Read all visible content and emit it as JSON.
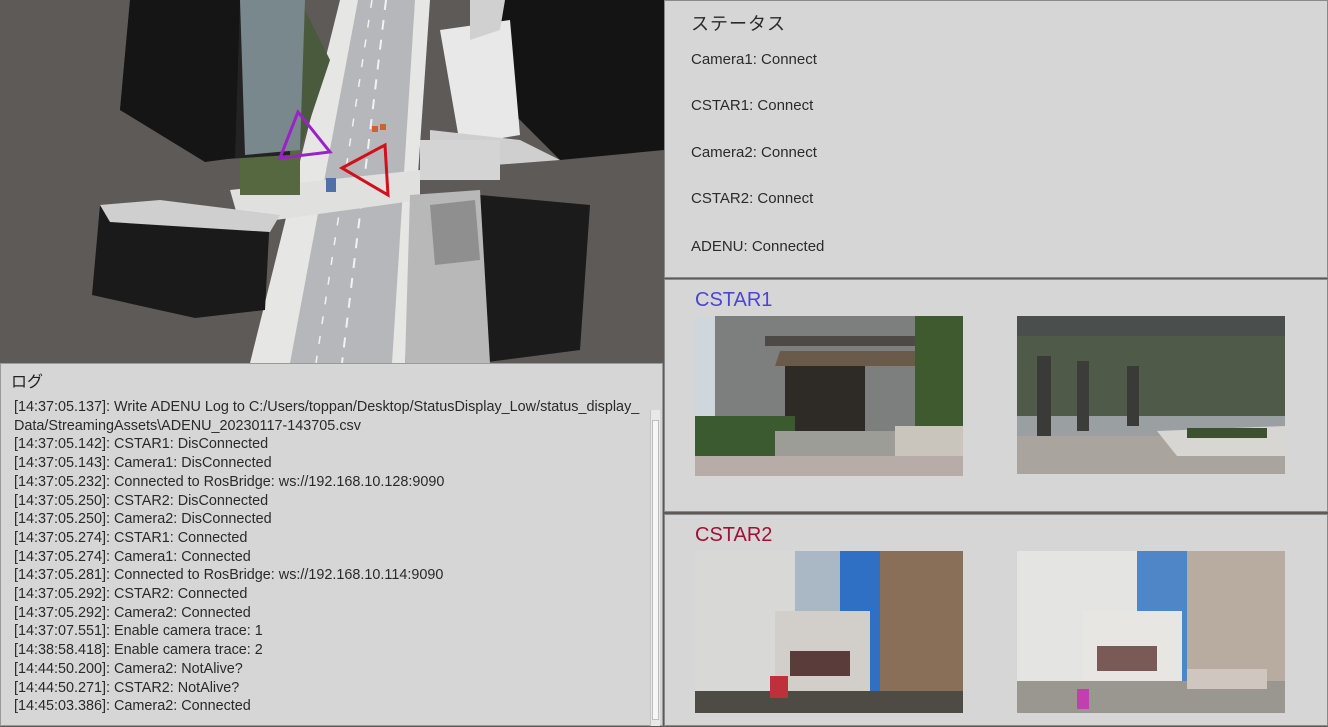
{
  "status": {
    "title": "ステータス",
    "items": [
      "Camera1: Connect",
      "CSTAR1: Connect",
      "Camera2: Connect",
      "CSTAR2: Connect",
      "ADENU: Connected"
    ]
  },
  "log": {
    "title": "ログ",
    "lines": [
      "[14:37:05.137]: Write ADENU Log to C:/Users/toppan/Desktop/StatusDisplay_Low/status_display_Data/StreamingAssets\\ADENU_20230117-143705.csv",
      "[14:37:05.142]: CSTAR1: DisConnected",
      "[14:37:05.143]: Camera1: DisConnected",
      "[14:37:05.232]: Connected to RosBridge: ws://192.168.10.128:9090",
      "[14:37:05.250]: CSTAR2: DisConnected",
      "[14:37:05.250]: Camera2: DisConnected",
      "[14:37:05.274]: CSTAR1: Connected",
      "[14:37:05.274]: Camera1: Connected",
      "[14:37:05.281]: Connected to RosBridge: ws://192.168.10.114:9090",
      "[14:37:05.292]: CSTAR2: Connected",
      "[14:37:05.292]: Camera2: Connected",
      "[14:37:07.551]: Enable camera trace: 1",
      "[14:38:58.418]: Enable camera trace: 2",
      "[14:44:50.200]: Camera2: NotAlive?",
      "[14:44:50.271]: CSTAR2: NotAlive?",
      "[14:45:03.386]: Camera2: Connected"
    ]
  },
  "cameras": {
    "cstar1": {
      "title": "CSTAR1",
      "color": "#4b45d6"
    },
    "cstar2": {
      "title": "CSTAR2",
      "color": "#a01035"
    }
  },
  "map": {
    "marker1_color": "#9a22c8",
    "marker2_color": "#d0101a"
  }
}
